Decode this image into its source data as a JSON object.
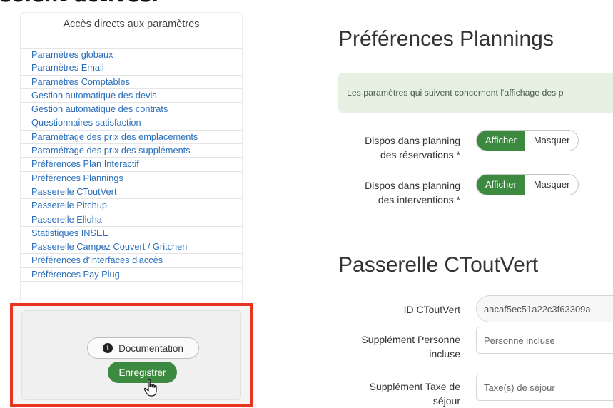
{
  "top_clip_text": "soient actives.",
  "sidebar": {
    "title": "Accès directs aux paramètres",
    "items": [
      "Paramètres globaux",
      "Paramètres Email",
      "Paramètres Comptables",
      "Gestion automatique des devis",
      "Gestion automatique des contrats",
      "Questionnaires satisfaction",
      "Paramétrage des prix des emplacements",
      "Paramétrage des prix des suppléments",
      "Préférences Plan Interactif",
      "Préférences Plannings",
      "Passerelle CToutVert",
      "Passerelle Pitchup",
      "Passerelle Elloha",
      "Statistiques INSEE",
      "Passerelle Campez Couvert / Gritchen",
      "Préférences d'interfaces d'accès",
      "Préférences Pay Plug"
    ]
  },
  "actions": {
    "documentation_label": "Documentation",
    "save_label": "Enregistrer"
  },
  "plannings": {
    "title": "Préférences Plannings",
    "banner_text": "Les paramètres qui suivent concernent l'affichage des p",
    "reservations_label_line1": "Dispos dans planning",
    "reservations_label_line2": "des réservations *",
    "interventions_label_line1": "Dispos dans planning",
    "interventions_label_line2": "des interventions *",
    "show_label": "Afficher",
    "hide_label": "Masquer"
  },
  "ctoutvert": {
    "title": "Passerelle CToutVert",
    "id_label": "ID CToutVert",
    "id_value": "aacaf5ec51a22c3f63309a",
    "supp_personne_label_line1": "Supplément Personne",
    "supp_personne_label_line2": "incluse",
    "supp_personne_placeholder": "Personne incluse",
    "supp_taxe_label_line1": "Supplément Taxe de",
    "supp_taxe_label_line2": "séjour",
    "supp_taxe_placeholder": "Taxe(s) de séjour"
  },
  "colors": {
    "accent_green": "#3c8a3f",
    "link_blue": "#2a6ebb",
    "highlight_red": "#e8351f",
    "banner_bg": "#e6f1e4"
  },
  "icons": {
    "info": "info-circle-icon",
    "cursor": "hand-pointer-icon"
  }
}
